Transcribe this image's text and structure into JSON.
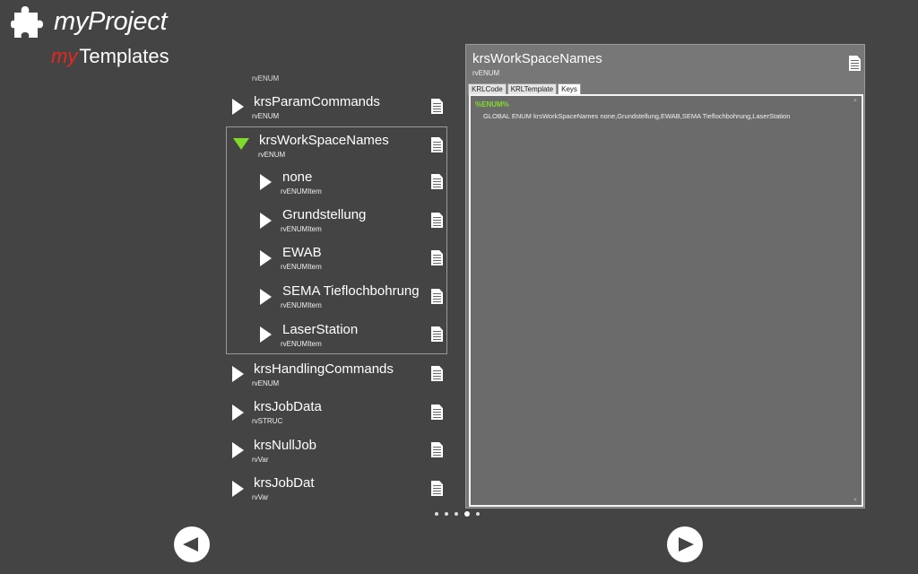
{
  "header": {
    "title": "myProject",
    "subtitle_prefix": "my",
    "subtitle": "Templates"
  },
  "tree": {
    "cut_item_type": "rvENUM",
    "items": [
      {
        "name": "krsParamCommands",
        "type": "rvENUM",
        "expanded": false
      },
      {
        "name": "krsWorkSpaceNames",
        "type": "rvENUM",
        "expanded": true,
        "children": [
          {
            "name": "none",
            "type": "rvENUMItem"
          },
          {
            "name": "Grundstellung",
            "type": "rvENUMItem"
          },
          {
            "name": "EWAB",
            "type": "rvENUMItem"
          },
          {
            "name": "SEMA Tieflochbohrung",
            "type": "rvENUMItem"
          },
          {
            "name": "LaserStation",
            "type": "rvENUMItem"
          }
        ]
      },
      {
        "name": "krsHandlingCommands",
        "type": "rvENUM",
        "expanded": false
      },
      {
        "name": "krsJobData",
        "type": "rvSTRUC",
        "expanded": false
      },
      {
        "name": "krsNullJob",
        "type": "rvVar",
        "expanded": false
      },
      {
        "name": "krsJobDat",
        "type": "rvVar",
        "expanded": false
      }
    ]
  },
  "panel": {
    "title": "krsWorkSpaceNames",
    "type": "rvENUM",
    "tabs": [
      "KRLCode",
      "KRLTemplate",
      "Keys"
    ],
    "active_tab": "Keys",
    "code_marker": "%ENUM%",
    "code_line": "GLOBAL ENUM krsWorkSpaceNames none,Grundstellung,EWAB,SEMA Tieflochbohrung,LaserStation"
  },
  "pagination": {
    "count": 5,
    "active_index": 3
  },
  "colors": {
    "background": "#444444",
    "accent_green": "#7fdc2a",
    "accent_red": "#e8281f",
    "panel": "#777777"
  }
}
